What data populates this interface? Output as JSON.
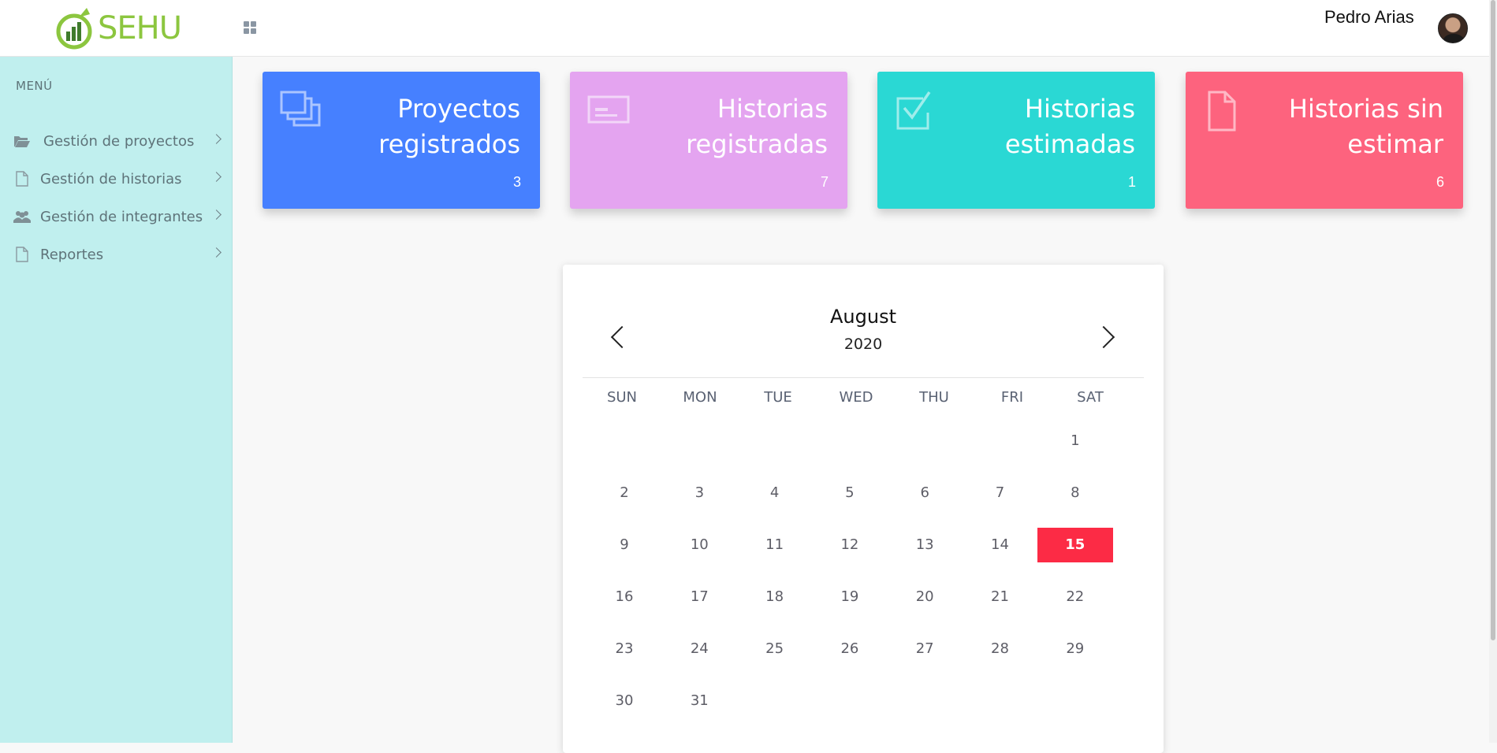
{
  "header": {
    "brand": "SEHU",
    "user_name": "Pedro Arias"
  },
  "sidebar": {
    "title": "MENÚ",
    "items": [
      {
        "label": "Gestión de proyectos",
        "icon": "folder-open-icon"
      },
      {
        "label": "Gestión de historias",
        "icon": "file-icon"
      },
      {
        "label": "Gestión de integrantes",
        "icon": "users-icon"
      },
      {
        "label": "Reportes",
        "icon": "file-icon"
      }
    ]
  },
  "cards": [
    {
      "line1": "Proyectos",
      "line2": "registrados",
      "count": "3",
      "color": "#4680ff",
      "icon": "clone-icon"
    },
    {
      "line1": "Historias",
      "line2": "registradas",
      "count": "7",
      "color": "#e4a4f0",
      "icon": "card-icon"
    },
    {
      "line1": "Historias",
      "line2": "estimadas",
      "count": "1",
      "color": "#2ad8d4",
      "icon": "check-square-icon"
    },
    {
      "line1": "Historias sin",
      "line2": "estimar",
      "count": "6",
      "color": "#fd637e",
      "icon": "file-icon"
    }
  ],
  "calendar": {
    "month": "August",
    "year": "2020",
    "weekdays": [
      "SUN",
      "MON",
      "TUE",
      "WED",
      "THU",
      "FRI",
      "SAT"
    ],
    "first_weekday_index": 6,
    "days_in_month": 31,
    "selected_day": 15,
    "selected_color": "#fc2b45"
  }
}
